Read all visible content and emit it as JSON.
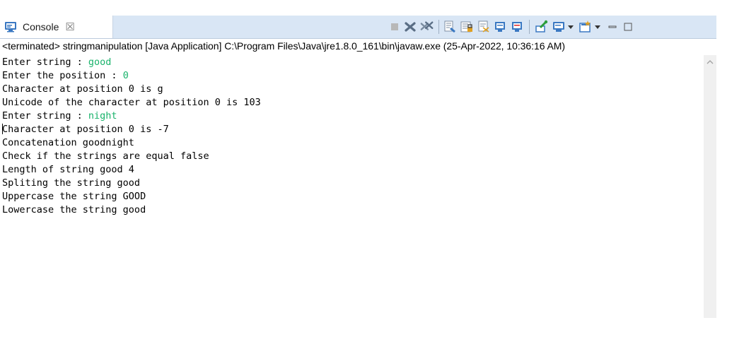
{
  "view": {
    "tab_title": "Console",
    "tab_close": "☒",
    "status_line": "<terminated> stringmanipulation [Java Application] C:\\Program Files\\Java\\jre1.8.0_161\\bin\\javaw.exe (25-Apr-2022, 10:36:16 AM)"
  },
  "toolbar": {
    "icons": [
      "stop-icon",
      "remove-launch-icon",
      "remove-all-terminated-icon",
      "clear-console-icon",
      "scroll-lock-icon",
      "word-wrap-icon",
      "show-when-stdout-changes-icon",
      "show-when-stderr-changes-icon",
      "pin-console-icon",
      "display-selected-console-icon",
      "open-console-icon",
      "minimize-icon",
      "maximize-icon"
    ]
  },
  "console": {
    "lines": [
      {
        "text": "Enter string : ",
        "input": "good"
      },
      {
        "text": "Enter the position : ",
        "input": "0"
      },
      {
        "text": "Character at position 0 is g",
        "input": ""
      },
      {
        "text": "Unicode of the character at position 0 is 103",
        "input": ""
      },
      {
        "text": "Enter string : ",
        "input": "night"
      },
      {
        "text": "Character at position 0 is -7",
        "input": ""
      },
      {
        "text": "Concatenation goodnight",
        "input": ""
      },
      {
        "text": "Check if the strings are equal false",
        "input": ""
      },
      {
        "text": "Length of string good 4",
        "input": ""
      },
      {
        "text": "Spliting the string good",
        "input": ""
      },
      {
        "text": "Uppercase the string GOOD",
        "input": ""
      },
      {
        "text": "Lowercase the string good",
        "input": ""
      }
    ]
  },
  "colors": {
    "input_text": "#19b36b",
    "tab_bar": "#d9e6f5"
  }
}
